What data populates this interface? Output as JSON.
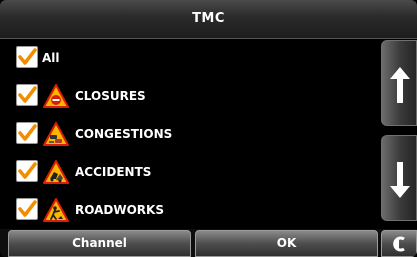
{
  "header": {
    "title": "TMC"
  },
  "list": {
    "items": [
      {
        "label": "All",
        "checked": true,
        "icon": null
      },
      {
        "label": "CLOSURES",
        "checked": true,
        "icon": "closure-warning-icon"
      },
      {
        "label": "CONGESTIONS",
        "checked": true,
        "icon": "congestion-warning-icon"
      },
      {
        "label": "ACCIDENTS",
        "checked": true,
        "icon": "accident-warning-icon"
      },
      {
        "label": "ROADWORKS",
        "checked": true,
        "icon": "roadworks-warning-icon"
      }
    ]
  },
  "scroll": {
    "up_icon": "arrow-up-icon",
    "down_icon": "arrow-down-icon"
  },
  "footer": {
    "channel_label": "Channel",
    "ok_label": "OK",
    "back_icon": "back-icon"
  },
  "colors": {
    "check": "#f28c00",
    "warning_fill": "#ffb400",
    "warning_border": "#d81e05"
  }
}
